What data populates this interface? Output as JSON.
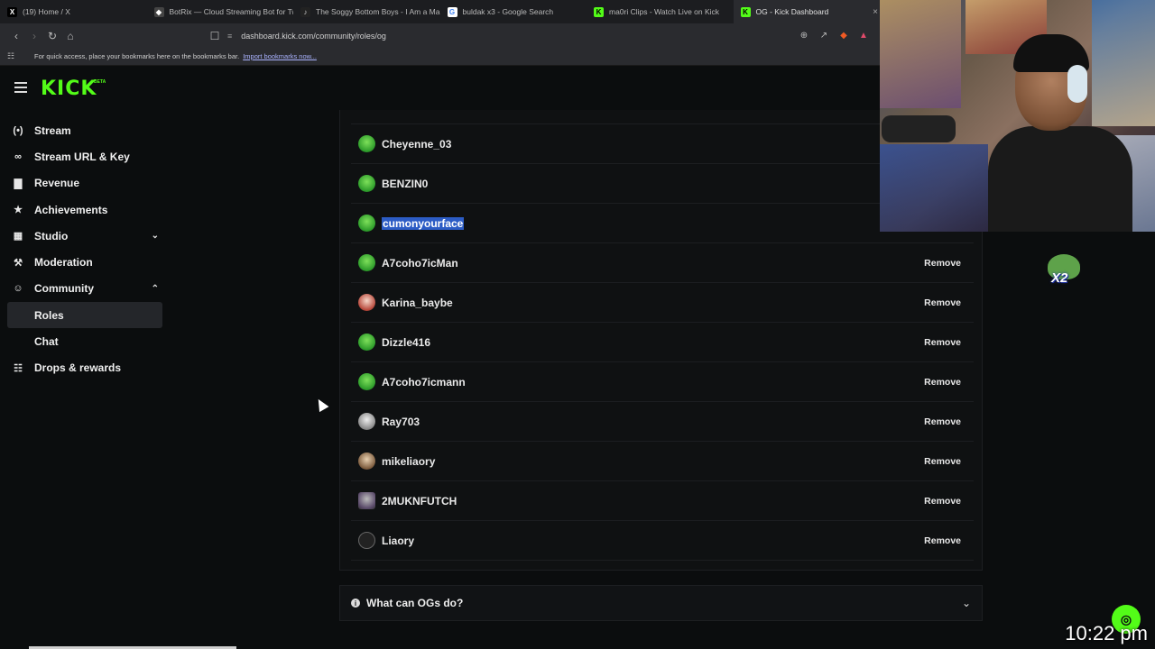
{
  "browser": {
    "tabs": [
      {
        "title": "(19) Home / X",
        "icon": "x-icon",
        "active": false
      },
      {
        "title": "BotRix — Cloud Streaming Bot for Tw",
        "icon": "botrix-icon",
        "active": false
      },
      {
        "title": "The Soggy Bottom Boys - I Am a Ma",
        "icon": "music-icon",
        "active": false
      },
      {
        "title": "buldak x3 - Google Search",
        "icon": "google-icon",
        "active": false
      },
      {
        "title": "ma0ri Clips - Watch Live on Kick",
        "icon": "kick-icon",
        "active": false
      },
      {
        "title": "OG - Kick Dashboard",
        "icon": "kick-icon",
        "active": true
      }
    ],
    "url": "dashboard.kick.com/community/roles/og",
    "bookmarks_text": "For quick access, place your bookmarks here on the bookmarks bar.",
    "bookmarks_link": "Import bookmarks now..."
  },
  "kick": {
    "logo": "KICK",
    "logo_badge": "BETA",
    "accent": "#53fc18"
  },
  "sidebar": {
    "items": [
      {
        "label": "Stream",
        "icon": "broadcast-icon"
      },
      {
        "label": "Stream URL & Key",
        "icon": "link-icon"
      },
      {
        "label": "Revenue",
        "icon": "bar-chart-icon"
      },
      {
        "label": "Achievements",
        "icon": "trophy-icon"
      },
      {
        "label": "Studio",
        "icon": "grid-icon",
        "chevron": "down"
      },
      {
        "label": "Moderation",
        "icon": "wrench-icon"
      },
      {
        "label": "Community",
        "icon": "users-icon",
        "chevron": "up"
      }
    ],
    "community_sub": [
      {
        "label": "Roles",
        "active": true
      },
      {
        "label": "Chat",
        "active": false
      }
    ],
    "drops": {
      "label": "Drops & rewards",
      "icon": "gift-icon"
    }
  },
  "og_list": {
    "users": [
      {
        "name": "Cheyenne_03",
        "avatar": "green",
        "remove": ""
      },
      {
        "name": "BENZIN0",
        "avatar": "green",
        "remove": ""
      },
      {
        "name": "cumonyourface",
        "avatar": "green",
        "remove": "",
        "selected": true
      },
      {
        "name": "A7coho7icMan",
        "avatar": "green",
        "remove": "Remove"
      },
      {
        "name": "Karina_baybe",
        "avatar": "red",
        "remove": "Remove"
      },
      {
        "name": "Dizzle416",
        "avatar": "green",
        "remove": "Remove"
      },
      {
        "name": "A7coho7icmann",
        "avatar": "green",
        "remove": "Remove"
      },
      {
        "name": "Ray703",
        "avatar": "grey",
        "remove": "Remove"
      },
      {
        "name": "mikeliaory",
        "avatar": "brown",
        "remove": "Remove"
      },
      {
        "name": "2MUKNFUTCH",
        "avatar": "purple",
        "remove": "Remove"
      },
      {
        "name": "Liaory",
        "avatar": "pixel",
        "remove": "Remove"
      }
    ]
  },
  "faq": {
    "label": "What can OGs do?"
  },
  "overlay": {
    "emote_text": "X2",
    "clock": "10:22 pm"
  }
}
